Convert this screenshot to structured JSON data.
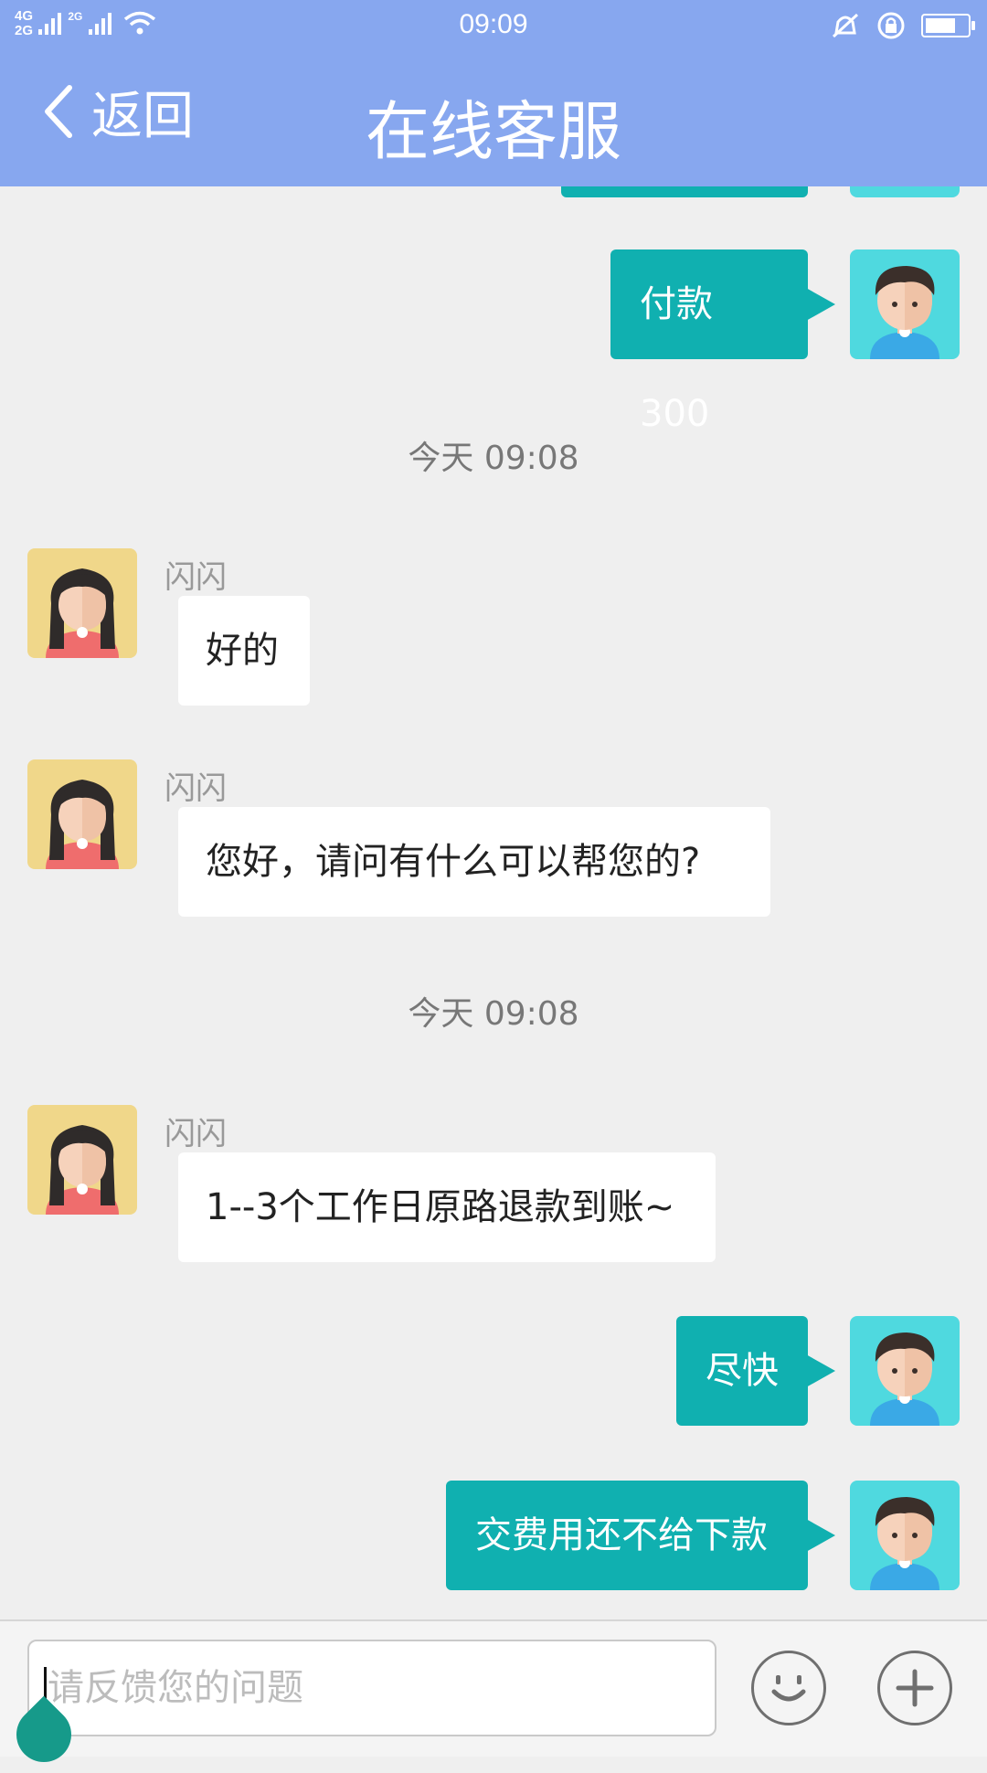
{
  "status_bar": {
    "network_top": "4G",
    "network_bottom": "2G",
    "network_2": "2G",
    "time": "09:09"
  },
  "header": {
    "back_label": "返回",
    "title": "在线客服"
  },
  "messages": {
    "out_payment": "付款300",
    "timestamp_1": "今天 09:08",
    "in_1_sender": "闪闪",
    "in_1_text": "好的",
    "in_2_sender": "闪闪",
    "in_2_text": "您好，请问有什么可以帮您的?",
    "timestamp_2": "今天 09:08",
    "in_3_sender": "闪闪",
    "in_3_text": "1--3个工作日原路退款到账~",
    "out_2_text": "尽快",
    "out_3_text": "交费用还不给下款"
  },
  "composer": {
    "placeholder": "请反馈您的问题"
  },
  "icons": {
    "back": "chevron-left-icon",
    "emoji": "smiley-icon",
    "add": "plus-icon",
    "wifi": "wifi-icon",
    "mute": "vibrate-mute-icon",
    "lock": "rotation-lock-icon",
    "battery": "battery-icon"
  },
  "colors": {
    "header": "#87a7ef",
    "outgoing_bubble": "#10b0b0",
    "incoming_bubble": "#ffffff",
    "background": "#efefef"
  }
}
